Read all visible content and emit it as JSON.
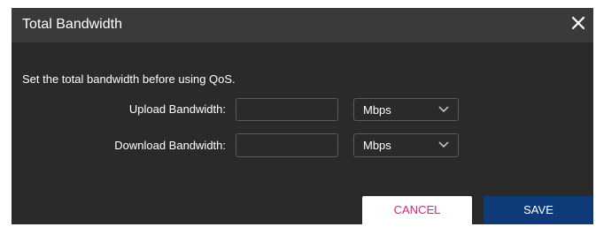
{
  "dialog": {
    "title": "Total Bandwidth",
    "intro": "Set the total bandwidth before using QoS.",
    "upload": {
      "label": "Upload Bandwidth:",
      "value": "",
      "unit": "Mbps"
    },
    "download": {
      "label": "Download Bandwidth:",
      "value": "",
      "unit": "Mbps"
    },
    "buttons": {
      "cancel": "CANCEL",
      "save": "SAVE"
    },
    "icons": {
      "close": "close-icon",
      "chevron": "chevron-down-icon"
    }
  },
  "colors": {
    "background": "#2a2a2a",
    "header": "#3a3a3a",
    "cancel_text": "#e1207e",
    "save_bg": "#0e3a7a"
  }
}
